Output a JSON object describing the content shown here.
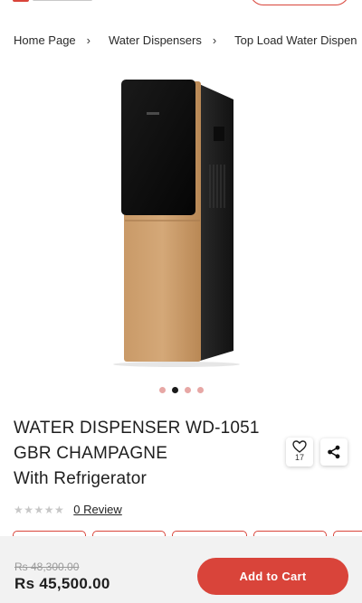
{
  "breadcrumb": {
    "items": [
      "Home Page",
      "Water Dispensers",
      "Top Load Water Dispen"
    ],
    "separator": "›"
  },
  "gallery": {
    "image_name": "water-dispenser-wd-1051-image",
    "slide_count": 4,
    "active_slide": 2
  },
  "product": {
    "title_lines": [
      "WATER DISPENSER WD-1051",
      "GBR CHAMPAGNE",
      "With Refrigerator"
    ],
    "wishlist_count": "17",
    "rating_stars": "★★★★★",
    "review_label": "0 Review"
  },
  "purchase": {
    "old_price": "Rs 48,300.00",
    "price": "Rs 45,500.00",
    "add_to_cart_label": "Add to Cart"
  },
  "colors": {
    "accent": "#d9443a",
    "dot_inactive": "#e7a7a5",
    "dot_active": "#1a1a1a",
    "bar_bg": "#f2f2f2"
  }
}
